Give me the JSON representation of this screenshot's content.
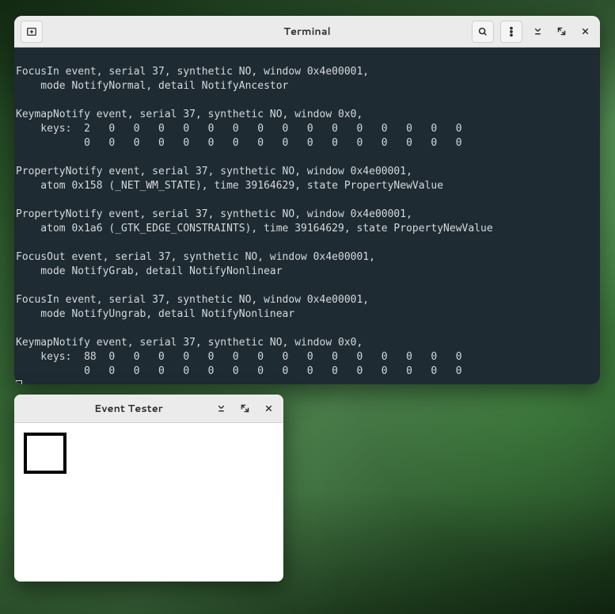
{
  "terminal": {
    "title": "Terminal",
    "output": "\nFocusIn event, serial 37, synthetic NO, window 0x4e00001,\n    mode NotifyNormal, detail NotifyAncestor\n\nKeymapNotify event, serial 37, synthetic NO, window 0x0,\n    keys:  2   0   0   0   0   0   0   0   0   0   0   0   0   0   0   0\n           0   0   0   0   0   0   0   0   0   0   0   0   0   0   0   0\n\nPropertyNotify event, serial 37, synthetic NO, window 0x4e00001,\n    atom 0x158 (_NET_WM_STATE), time 39164629, state PropertyNewValue\n\nPropertyNotify event, serial 37, synthetic NO, window 0x4e00001,\n    atom 0x1a6 (_GTK_EDGE_CONSTRAINTS), time 39164629, state PropertyNewValue\n\nFocusOut event, serial 37, synthetic NO, window 0x4e00001,\n    mode NotifyGrab, detail NotifyNonlinear\n\nFocusIn event, serial 37, synthetic NO, window 0x4e00001,\n    mode NotifyUngrab, detail NotifyNonlinear\n\nKeymapNotify event, serial 37, synthetic NO, window 0x0,\n    keys:  88  0   0   0   0   0   0   0   0   0   0   0   0   0   0   0\n           0   0   0   0   0   0   0   0   0   0   0   0   0   0   0   0"
  },
  "event_tester": {
    "title": "Event Tester"
  }
}
